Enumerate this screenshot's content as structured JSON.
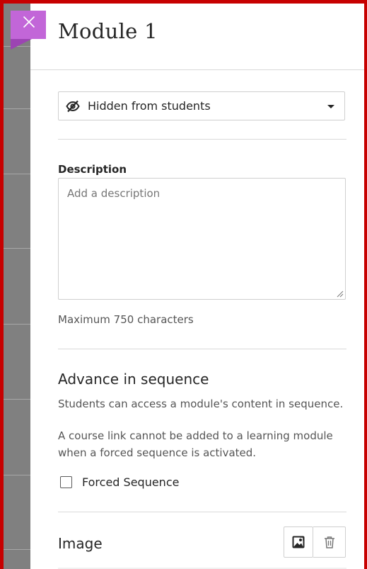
{
  "panel": {
    "title": "Module 1",
    "close_icon": "close-icon"
  },
  "visibility": {
    "selected": "Hidden from students",
    "icon": "eye-slash-icon"
  },
  "description": {
    "label": "Description",
    "placeholder": "Add a description",
    "value": "",
    "hint": "Maximum 750 characters"
  },
  "sequence": {
    "heading": "Advance in sequence",
    "text1": "Students can access a module's content in sequence.",
    "text2": "A course link cannot be added to a learning module when a forced sequence is activated.",
    "checkbox_label": "Forced Sequence",
    "checked": false
  },
  "image": {
    "heading": "Image",
    "upload_icon": "image-icon",
    "delete_icon": "trash-icon"
  },
  "colors": {
    "frame": "#c70000",
    "close_tab": "#c266d8",
    "text": "#262626"
  }
}
